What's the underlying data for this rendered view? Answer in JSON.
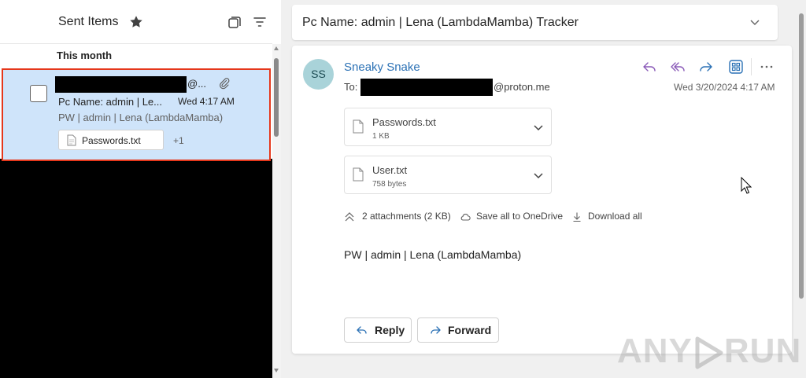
{
  "list": {
    "folder_title": "Sent Items",
    "group_label": "This month",
    "item": {
      "from_suffix": "@...",
      "subject": "Pc Name: admin | Le...",
      "time": "Wed 4:17 AM",
      "preview": "PW | admin | Lena (LambdaMamba)",
      "attachment_name": "Passwords.txt",
      "more_attachments": "+1"
    }
  },
  "reading": {
    "subject": "Pc Name: admin | Lena (LambdaMamba) Tracker",
    "avatar_initials": "SS",
    "sender": "Sneaky Snake",
    "to_label": "To:",
    "to_suffix": "@proton.me",
    "date": "Wed 3/20/2024 4:17 AM",
    "attachments": [
      {
        "name": "Passwords.txt",
        "size": "1 KB"
      },
      {
        "name": "User.txt",
        "size": "758 bytes"
      }
    ],
    "attachment_summary": "2 attachments (2 KB)",
    "save_all": "Save all to OneDrive",
    "download_all": "Download all",
    "body": "PW | admin | Lena (LambdaMamba)",
    "reply_label": "Reply",
    "forward_label": "Forward"
  },
  "watermark": {
    "left": "ANY",
    "right": "RUN"
  },
  "colors": {
    "selected_bg": "#cfe4fa",
    "highlight_border": "#e5371b",
    "sender_link": "#2b71b5",
    "avatar_bg": "#a9d3d9",
    "action_purple": "#8a5ab8",
    "action_blue": "#2b71b5"
  },
  "icons": [
    "star-icon",
    "select-icon",
    "filter-icon",
    "paperclip-icon",
    "file-icon",
    "chevron-down-icon",
    "reply-icon",
    "reply-all-icon",
    "forward-icon",
    "apps-icon",
    "more-icon",
    "collapse-icon",
    "cloud-icon",
    "download-icon",
    "cursor-icon"
  ]
}
